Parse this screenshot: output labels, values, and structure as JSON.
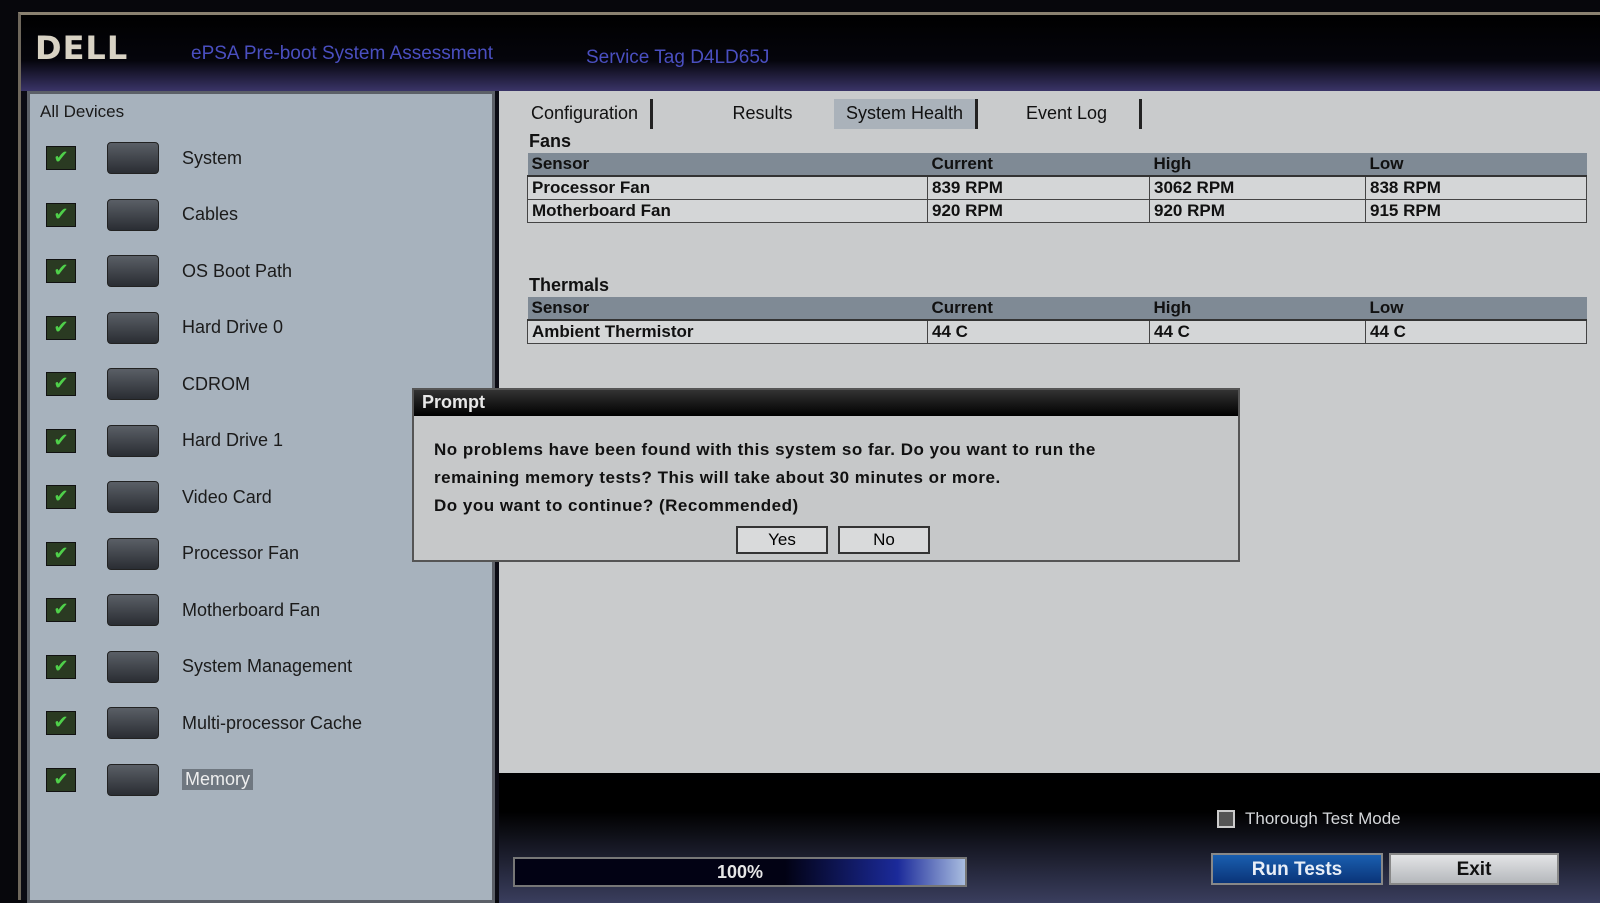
{
  "header": {
    "logo": "DELL",
    "title": "ePSA Pre-boot System Assessment",
    "service_tag": "Service Tag D4LD65J"
  },
  "sidebar": {
    "title": "All Devices",
    "items": [
      {
        "label": "System",
        "icon": "laptop-icon"
      },
      {
        "label": "Cables",
        "icon": "cable-icon"
      },
      {
        "label": "OS Boot Path",
        "icon": "boot-path-icon"
      },
      {
        "label": "Hard Drive 0",
        "icon": "hard-drive-icon"
      },
      {
        "label": "CDROM",
        "icon": "cdrom-icon"
      },
      {
        "label": "Hard Drive 1",
        "icon": "hard-drive-icon"
      },
      {
        "label": "Video Card",
        "icon": "video-card-icon"
      },
      {
        "label": "Processor Fan",
        "icon": "fan-icon"
      },
      {
        "label": "Motherboard Fan",
        "icon": "fan-icon"
      },
      {
        "label": "System Management",
        "icon": "system-management-icon"
      },
      {
        "label": "Multi-processor Cache",
        "icon": "cpu-icon"
      },
      {
        "label": "Memory",
        "icon": "memory-icon"
      }
    ]
  },
  "tabs": [
    "Configuration",
    "Results",
    "System Health",
    "Event Log"
  ],
  "fans": {
    "title": "Fans",
    "headers": [
      "Sensor",
      "Current",
      "High",
      "Low"
    ],
    "rows": [
      [
        "Processor Fan",
        "839 RPM",
        "3062 RPM",
        "838 RPM"
      ],
      [
        "Motherboard Fan",
        "920 RPM",
        "920 RPM",
        "915 RPM"
      ]
    ]
  },
  "thermals": {
    "title": "Thermals",
    "headers": [
      "Sensor",
      "Current",
      "High",
      "Low"
    ],
    "rows": [
      [
        "Ambient Thermistor",
        "44 C",
        "44 C",
        "44 C"
      ]
    ]
  },
  "dialog": {
    "title": "Prompt",
    "line1": "No problems have been found with this system so far. Do you want to run the",
    "line2": "remaining memory tests?  This will take about 30 minutes or more.",
    "line3": "Do you want to continue? (Recommended)",
    "yes": "Yes",
    "no": "No"
  },
  "footer": {
    "progress": "100%",
    "thorough": "Thorough Test Mode",
    "run": "Run Tests",
    "exit": "Exit"
  }
}
